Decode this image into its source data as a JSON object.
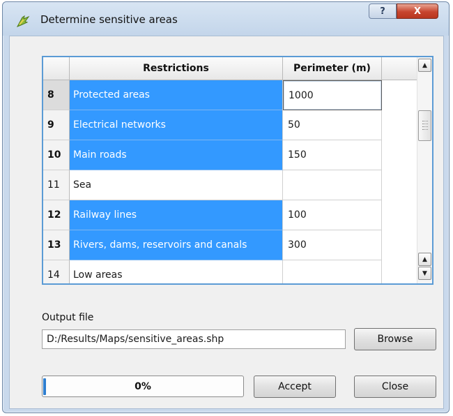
{
  "window": {
    "title": "Determine sensitive areas",
    "help_label": "?",
    "close_label": "X"
  },
  "table": {
    "columns": [
      "Restrictions",
      "Perimeter (m)"
    ],
    "rows": [
      {
        "num": "8",
        "restriction": "Protected areas",
        "perimeter": "1000",
        "selected": true,
        "editing": true
      },
      {
        "num": "9",
        "restriction": "Electrical networks",
        "perimeter": "50",
        "selected": true
      },
      {
        "num": "10",
        "restriction": "Main roads",
        "perimeter": "150",
        "selected": true
      },
      {
        "num": "11",
        "restriction": "Sea",
        "perimeter": "",
        "selected": false
      },
      {
        "num": "12",
        "restriction": "Railway lines",
        "perimeter": "100",
        "selected": true
      },
      {
        "num": "13",
        "restriction": "Rivers, dams, reservoirs and canals",
        "perimeter": "300",
        "selected": true
      },
      {
        "num": "14",
        "restriction": "Low areas",
        "perimeter": "",
        "selected": false
      }
    ],
    "scrollbar_icons": {
      "up": "arrow-up-icon",
      "down": "arrow-down-icon"
    }
  },
  "output": {
    "label": "Output file",
    "value": "D:/Results/Maps/sensitive_areas.shp",
    "browse_label": "Browse"
  },
  "progress": {
    "text": "0%",
    "value": 0
  },
  "actions": {
    "accept_label": "Accept",
    "close_label": "Close"
  },
  "colors": {
    "selection": "#3399ff",
    "progress": "#3a8fd9",
    "close_button": "#c7452e"
  }
}
